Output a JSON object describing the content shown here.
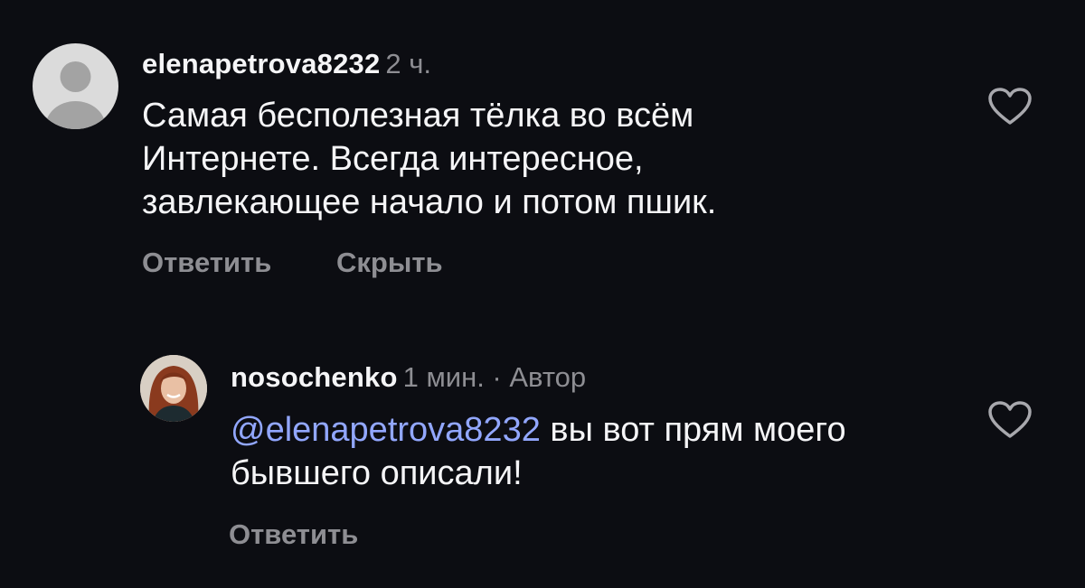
{
  "comments": [
    {
      "username": "elenapetrova8232",
      "meta": "2 ч.",
      "avatar": "default-user-icon",
      "text_lines": [
        "Самая бесполезная тёлка во всём",
        "Интернете. Всегда интересное,",
        "завлекающее начало и потом пшик."
      ],
      "actions": {
        "reply": "Ответить",
        "hide": "Скрыть"
      },
      "like_icon": "heart-outline-icon"
    },
    {
      "username": "nosochenko",
      "meta": "1 мин. · Автор",
      "avatar": "user-photo",
      "mention": "@elenapetrova8232",
      "text_line1_rest": " вы вот прям моего",
      "text_line2": "бывшего описали!",
      "actions": {
        "reply": "Ответить"
      },
      "like_icon": "heart-outline-icon"
    }
  ],
  "colors": {
    "background": "#0c0d12",
    "text": "#f5f5f7",
    "muted": "#8e8e93",
    "mention": "#92a7ff"
  }
}
